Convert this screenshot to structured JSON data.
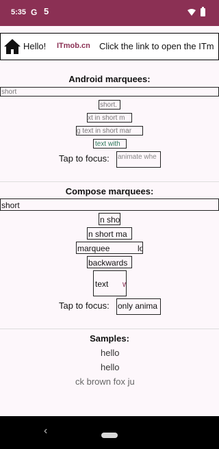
{
  "status_bar": {
    "time": "5:35",
    "google_icon": "G",
    "notification_icon": "5"
  },
  "banner": {
    "hello": "Hello!",
    "site": "ITmob.cn",
    "promo": "Click the link to open the ITm"
  },
  "android": {
    "title": "Android marquees:",
    "items": [
      "short",
      "short.",
      "xt in short m",
      "g text in short mar",
      "text with"
    ],
    "tap_label": "Tap to focus:",
    "focus_text": "animate whe"
  },
  "compose": {
    "title": "Compose marquees:",
    "items": [
      "short",
      "n sho",
      "n short ma",
      "marquee",
      "lo",
      "backwards",
      "text",
      "w"
    ],
    "tap_label": "Tap to focus:",
    "focus_text": "only anima"
  },
  "samples": {
    "title": "Samples:",
    "items": [
      "hello",
      "hello",
      "ck brown fox ju"
    ]
  },
  "nav": {
    "back": "‹"
  }
}
